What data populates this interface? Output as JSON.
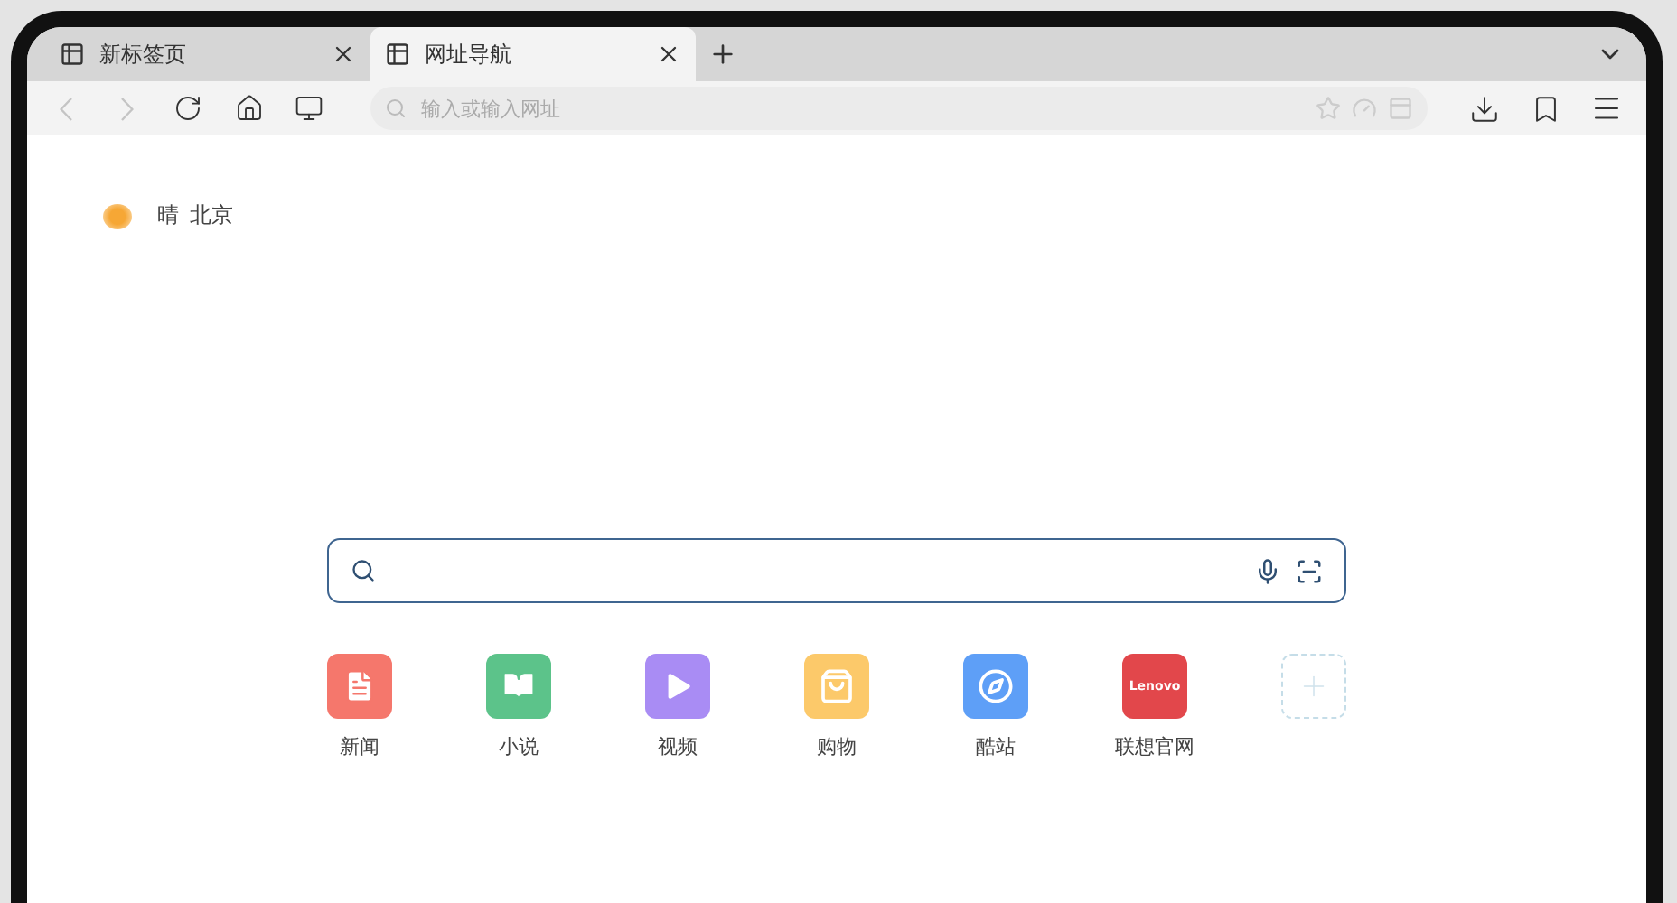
{
  "tabs": [
    {
      "label": "新标签页",
      "selected": false
    },
    {
      "label": "网址导航",
      "selected": true
    }
  ],
  "toolbar": {
    "back_disabled": true,
    "forward_disabled": true
  },
  "address_bar": {
    "placeholder": "输入或输入网址"
  },
  "weather": {
    "condition": "晴",
    "city": "北京"
  },
  "shortcuts": [
    {
      "kind": "news",
      "label": "新闻",
      "color": "#f5776c"
    },
    {
      "kind": "book",
      "label": "小说",
      "color": "#5cc38a"
    },
    {
      "kind": "video",
      "label": "视频",
      "color": "#a98cf4"
    },
    {
      "kind": "shop",
      "label": "购物",
      "color": "#fcc96a"
    },
    {
      "kind": "compass",
      "label": "酷站",
      "color": "#5e9ff7"
    },
    {
      "kind": "logo",
      "label": "联想官网",
      "color": "#e2474b",
      "logo_text": "Lenovo"
    },
    {
      "kind": "add"
    }
  ]
}
